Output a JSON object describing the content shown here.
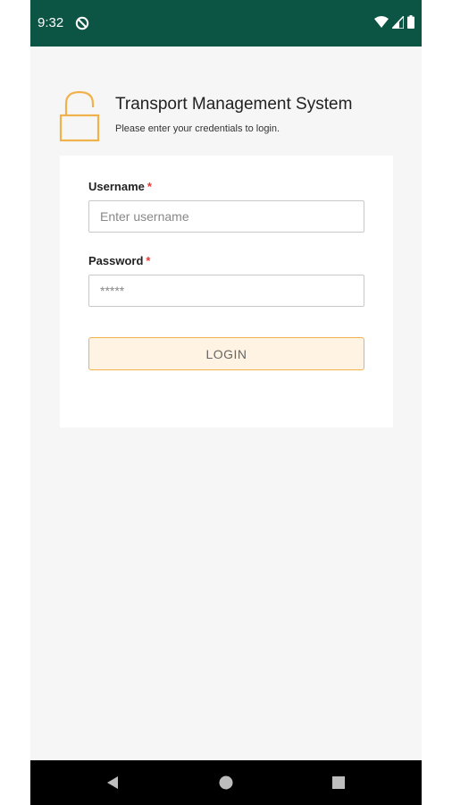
{
  "status_bar": {
    "time": "9:32",
    "background": "#0c5545",
    "left_icon": "do-not-disturb-icon",
    "right_icons": [
      "wifi-icon",
      "cell-signal-icon",
      "battery-icon"
    ]
  },
  "header": {
    "icon": "unlock-icon",
    "title": "Transport Management System",
    "subtitle": "Please enter your credentials to login."
  },
  "form": {
    "username": {
      "label": "Username",
      "required_mark": "*",
      "placeholder": "Enter username",
      "value": ""
    },
    "password": {
      "label": "Password",
      "required_mark": "*",
      "placeholder": "*****",
      "value": ""
    },
    "login_label": "LOGIN"
  },
  "nav_bar": {
    "buttons": [
      "back-icon",
      "home-icon",
      "recents-icon"
    ]
  },
  "colors": {
    "accent": "#f0b24d",
    "status_bar": "#0c5545",
    "required": "#e53935",
    "button_fill": "#fff3e3"
  }
}
